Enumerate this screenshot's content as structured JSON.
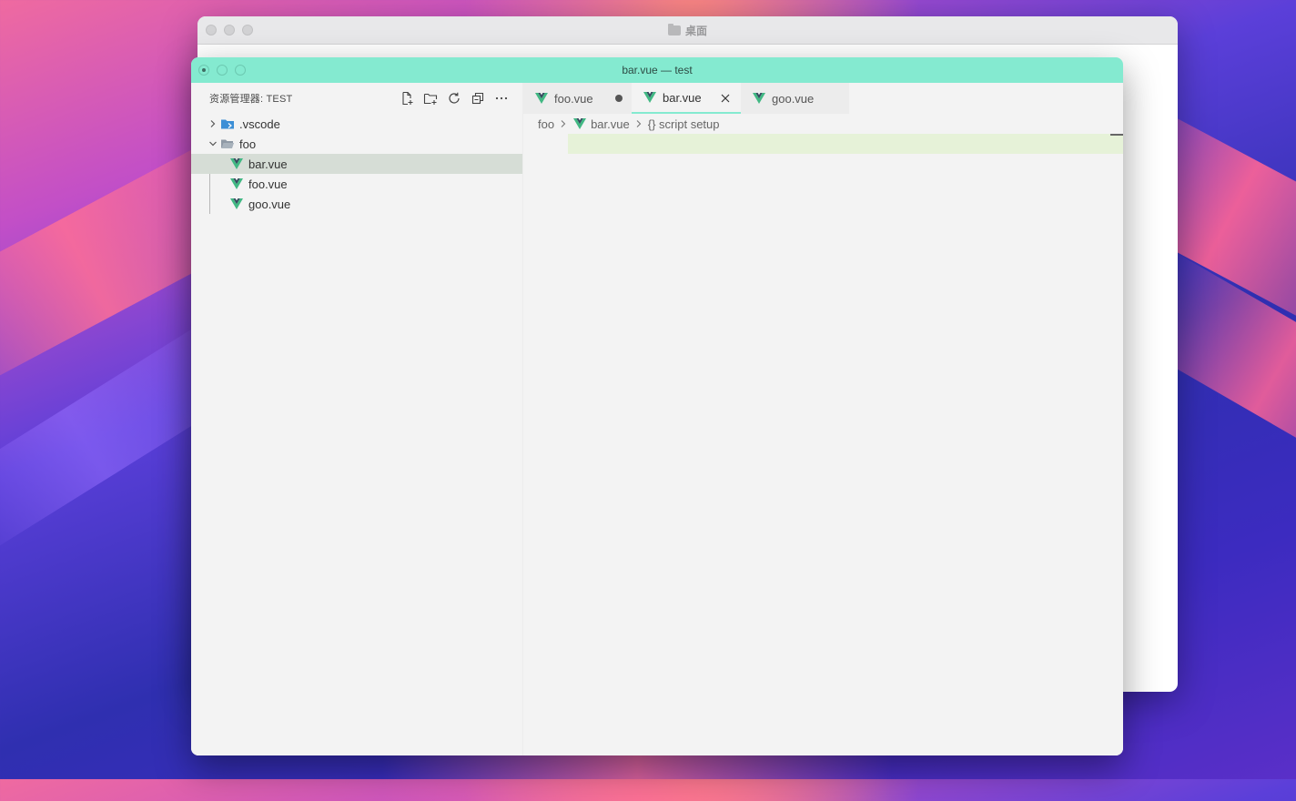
{
  "finder_window": {
    "title": "桌面",
    "folder_icon": "folder-icon"
  },
  "vscode": {
    "title": "bar.vue — test",
    "accent_color": "#84ead0",
    "explorer": {
      "title": "资源管理器: TEST",
      "actions": [
        {
          "name": "new-file-icon"
        },
        {
          "name": "new-folder-icon"
        },
        {
          "name": "refresh-icon"
        },
        {
          "name": "collapse-all-icon"
        },
        {
          "name": "more-actions-icon"
        }
      ],
      "tree": {
        "vscode_folder": ".vscode",
        "foo_folder": "foo",
        "files": [
          "bar.vue",
          "foo.vue",
          "goo.vue"
        ],
        "selected": "bar.vue"
      }
    },
    "tabs": [
      {
        "label": "foo.vue",
        "dirty": true
      },
      {
        "label": "bar.vue",
        "active": true
      },
      {
        "label": "goo.vue"
      }
    ],
    "breadcrumbs": {
      "folder": "foo",
      "file": "bar.vue",
      "symbol": "{} script setup"
    }
  }
}
